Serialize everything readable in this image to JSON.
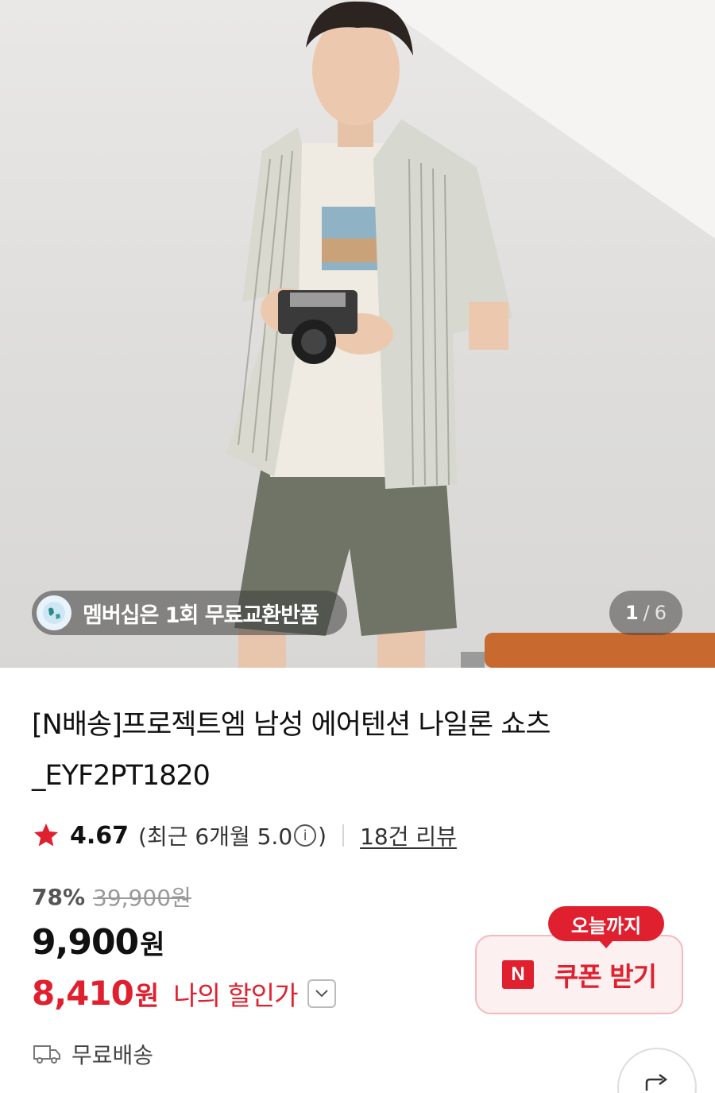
{
  "hero": {
    "membership_text": "멤버십은 1회 무료교환반품",
    "membership_icon": "globe-icon",
    "pager_current": "1",
    "pager_separator": "/",
    "pager_total": "6"
  },
  "product": {
    "title_line1": "[N배송]프로젝트엠 남성 에어텐션 나일론 쇼츠",
    "title_line2": "_EYF2PT1820"
  },
  "rating": {
    "score": "4.67",
    "recent_open": "(최근 6개월 5.0",
    "recent_close": ")",
    "info_icon_glyph": "i",
    "reviews_link": "18건 리뷰",
    "star_color": "#e0202e"
  },
  "price": {
    "discount_rate": "78%",
    "original_price": "39,900원",
    "sale_price": "9,900",
    "sale_unit": "원",
    "my_price": "8,410",
    "my_price_unit": "원",
    "my_price_label": "나의 할인가"
  },
  "shipping": {
    "icon": "truck-icon",
    "label": "무료배송"
  },
  "coupon": {
    "tag": "오늘까지",
    "badge": "N",
    "label": "쿠폰 받기"
  },
  "colors": {
    "accent_red": "#e0202e",
    "coupon_bg": "#fdf0f1",
    "coupon_border": "#f4b9bf"
  }
}
